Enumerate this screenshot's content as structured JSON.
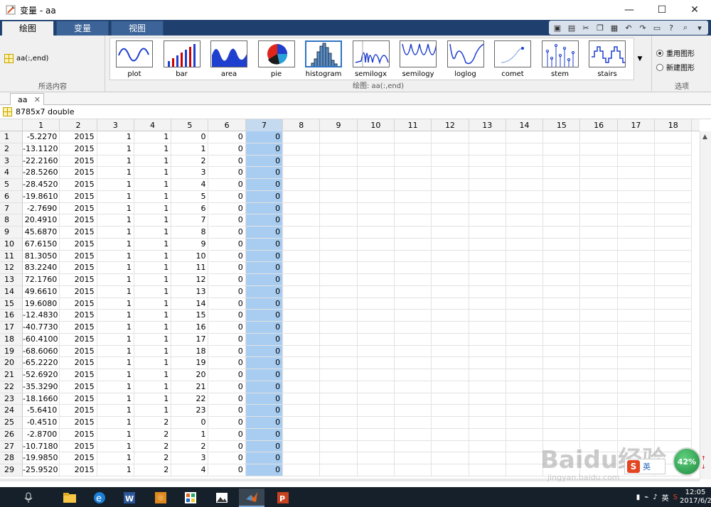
{
  "window": {
    "title": "变量 - aa",
    "controls": [
      "—",
      "☐",
      "✕"
    ]
  },
  "ribbon_tabs": [
    {
      "label": "绘图",
      "active": true
    },
    {
      "label": "变量",
      "active": false
    },
    {
      "label": "视图",
      "active": false
    }
  ],
  "selection": {
    "item": "aa(:,end)",
    "section_label": "所选内容"
  },
  "gallery": {
    "section_label": "绘图: aa(:,end)",
    "items": [
      "plot",
      "bar",
      "area",
      "pie",
      "histogram",
      "semilogx",
      "semilogy",
      "loglog",
      "comet",
      "stem",
      "stairs"
    ],
    "active": "histogram"
  },
  "options": {
    "section_label": "选项",
    "reuse": "重用图形",
    "new": "新建图形"
  },
  "doc_tab": {
    "label": "aa",
    "close": "✕"
  },
  "info": {
    "size_text": "8785x7 double"
  },
  "colors": {
    "selected_column": "#a9cdf0",
    "tab_bar": "#1f3f6e",
    "accent": "#2f74c2"
  },
  "sheet": {
    "columns": [
      "1",
      "2",
      "3",
      "4",
      "5",
      "6",
      "7",
      "8",
      "9",
      "10",
      "11",
      "12",
      "13",
      "14",
      "15",
      "16",
      "17",
      "18"
    ],
    "selected_column": "7",
    "rows": [
      [
        "1",
        "-5.2270",
        "2015",
        "1",
        "1",
        "0",
        "0",
        "0"
      ],
      [
        "2",
        "-13.1120",
        "2015",
        "1",
        "1",
        "1",
        "0",
        "0"
      ],
      [
        "3",
        "-22.2160",
        "2015",
        "1",
        "1",
        "2",
        "0",
        "0"
      ],
      [
        "4",
        "-28.5260",
        "2015",
        "1",
        "1",
        "3",
        "0",
        "0"
      ],
      [
        "5",
        "-28.4520",
        "2015",
        "1",
        "1",
        "4",
        "0",
        "0"
      ],
      [
        "6",
        "-19.8610",
        "2015",
        "1",
        "1",
        "5",
        "0",
        "0"
      ],
      [
        "7",
        "-2.7690",
        "2015",
        "1",
        "1",
        "6",
        "0",
        "0"
      ],
      [
        "8",
        "20.4910",
        "2015",
        "1",
        "1",
        "7",
        "0",
        "0"
      ],
      [
        "9",
        "45.6870",
        "2015",
        "1",
        "1",
        "8",
        "0",
        "0"
      ],
      [
        "10",
        "67.6150",
        "2015",
        "1",
        "1",
        "9",
        "0",
        "0"
      ],
      [
        "11",
        "81.3050",
        "2015",
        "1",
        "1",
        "10",
        "0",
        "0"
      ],
      [
        "12",
        "83.2240",
        "2015",
        "1",
        "1",
        "11",
        "0",
        "0"
      ],
      [
        "13",
        "72.1760",
        "2015",
        "1",
        "1",
        "12",
        "0",
        "0"
      ],
      [
        "14",
        "49.6610",
        "2015",
        "1",
        "1",
        "13",
        "0",
        "0"
      ],
      [
        "15",
        "19.6080",
        "2015",
        "1",
        "1",
        "14",
        "0",
        "0"
      ],
      [
        "16",
        "-12.4830",
        "2015",
        "1",
        "1",
        "15",
        "0",
        "0"
      ],
      [
        "17",
        "-40.7730",
        "2015",
        "1",
        "1",
        "16",
        "0",
        "0"
      ],
      [
        "18",
        "-60.4100",
        "2015",
        "1",
        "1",
        "17",
        "0",
        "0"
      ],
      [
        "19",
        "-68.6060",
        "2015",
        "1",
        "1",
        "18",
        "0",
        "0"
      ],
      [
        "20",
        "-65.2220",
        "2015",
        "1",
        "1",
        "19",
        "0",
        "0"
      ],
      [
        "21",
        "-52.6920",
        "2015",
        "1",
        "1",
        "20",
        "0",
        "0"
      ],
      [
        "22",
        "-35.3290",
        "2015",
        "1",
        "1",
        "21",
        "0",
        "0"
      ],
      [
        "23",
        "-18.1660",
        "2015",
        "1",
        "1",
        "22",
        "0",
        "0"
      ],
      [
        "24",
        "-5.6410",
        "2015",
        "1",
        "1",
        "23",
        "0",
        "0"
      ],
      [
        "25",
        "-0.4510",
        "2015",
        "1",
        "2",
        "0",
        "0",
        "0"
      ],
      [
        "26",
        "-2.8700",
        "2015",
        "1",
        "2",
        "1",
        "0",
        "0"
      ],
      [
        "27",
        "-10.7180",
        "2015",
        "1",
        "2",
        "2",
        "0",
        "0"
      ],
      [
        "28",
        "-19.9850",
        "2015",
        "1",
        "2",
        "3",
        "0",
        "0"
      ],
      [
        "29",
        "-25.9520",
        "2015",
        "1",
        "2",
        "4",
        "0",
        "0"
      ]
    ]
  },
  "taskbar": {
    "apps": [
      "microphone-icon",
      "file-explorer-icon",
      "edge-icon",
      "word-icon",
      "app-icon",
      "paint-icon",
      "photos-icon",
      "matlab-icon",
      "powerpoint-icon"
    ],
    "active_app": "matlab-icon",
    "ime": "英",
    "clock_time": "12:05",
    "clock_date": "2017/6/2"
  },
  "overlay": {
    "speed_percent": "42%",
    "ime_text": "英",
    "watermark": "Baidu经验",
    "watermark_sub": "jingyan.baidu.com"
  }
}
